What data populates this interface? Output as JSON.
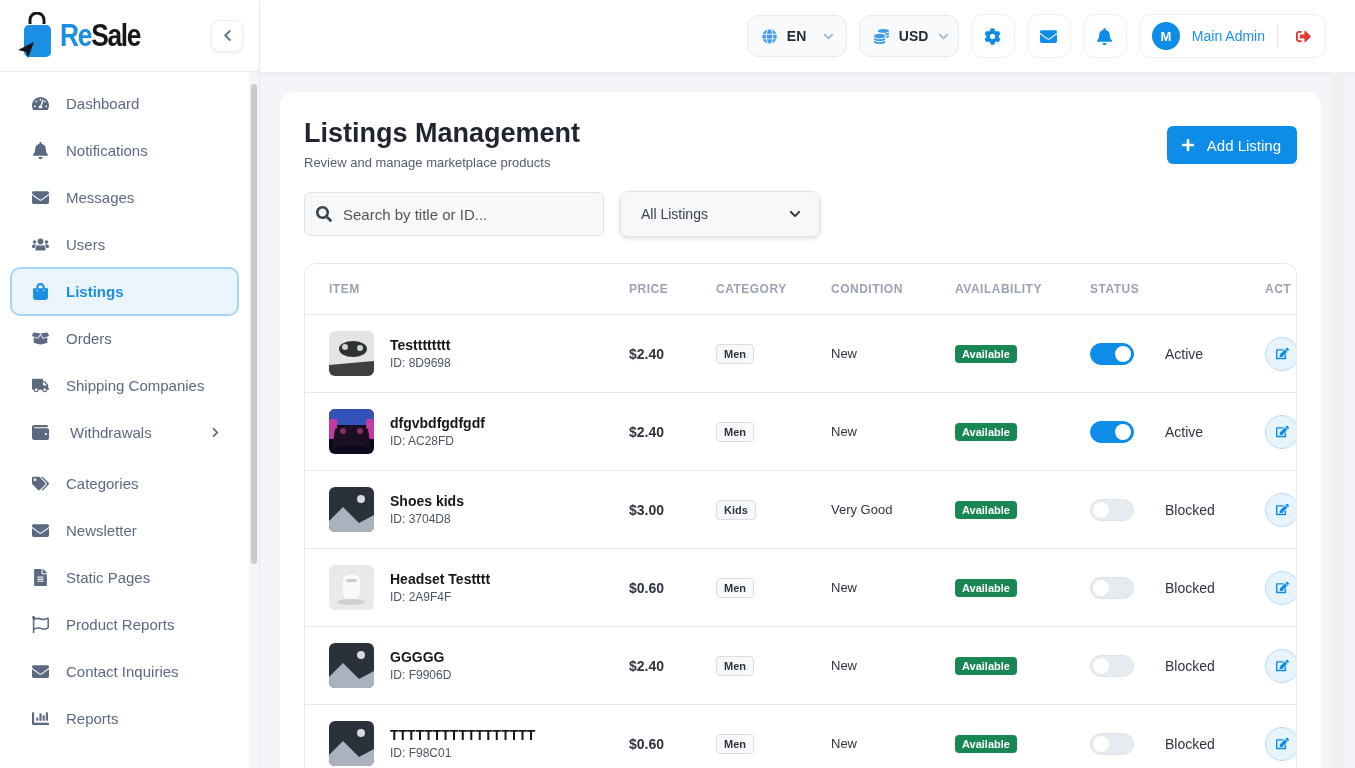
{
  "logo": {
    "prefix": "Re",
    "suffix": "Sale"
  },
  "sidebar": {
    "items": [
      {
        "label": "Dashboard",
        "selected": false,
        "kind": "link"
      },
      {
        "label": "Notifications",
        "selected": false,
        "kind": "link"
      },
      {
        "label": "Messages",
        "selected": false,
        "kind": "link"
      },
      {
        "label": "Users",
        "selected": false,
        "kind": "link"
      },
      {
        "label": "Listings",
        "selected": true,
        "kind": "link"
      },
      {
        "label": "Orders",
        "selected": false,
        "kind": "link"
      },
      {
        "label": "Shipping Companies",
        "selected": false,
        "kind": "link"
      },
      {
        "label": "Withdrawals",
        "selected": false,
        "kind": "group"
      },
      {
        "label": "Categories",
        "selected": false,
        "kind": "link"
      },
      {
        "label": "Newsletter",
        "selected": false,
        "kind": "link"
      },
      {
        "label": "Static Pages",
        "selected": false,
        "kind": "link"
      },
      {
        "label": "Product Reports",
        "selected": false,
        "kind": "link"
      },
      {
        "label": "Contact Inquiries",
        "selected": false,
        "kind": "link"
      },
      {
        "label": "Reports",
        "selected": false,
        "kind": "link"
      }
    ]
  },
  "header": {
    "language": "EN",
    "currency": "USD",
    "user": {
      "initial": "M",
      "name": "Main Admin"
    }
  },
  "page": {
    "title": "Listings Management",
    "subtitle": "Review and manage marketplace products",
    "add_button": "Add Listing",
    "search": {
      "placeholder": "Search by title or ID..."
    },
    "filter": {
      "value": "All Listings"
    }
  },
  "table": {
    "columns": [
      "ITEM",
      "PRICE",
      "CATEGORY",
      "CONDITION",
      "AVAILABILITY",
      "STATUS",
      "ACT"
    ],
    "rows": [
      {
        "name": "Testttttttt",
        "id": "ID: 8D9698",
        "price": "$2.40",
        "category": "Men",
        "condition": "New",
        "availability": "Available",
        "active": true,
        "status": "Active"
      },
      {
        "name": "dfgvbdfgdfgdf",
        "id": "ID: AC28FD",
        "price": "$2.40",
        "category": "Men",
        "condition": "New",
        "availability": "Available",
        "active": true,
        "status": "Active"
      },
      {
        "name": "Shoes kids",
        "id": "ID: 3704D8",
        "price": "$3.00",
        "category": "Kids",
        "condition": "Very Good",
        "availability": "Available",
        "active": false,
        "status": "Blocked",
        "kind": "placeholder"
      },
      {
        "name": "Headset Testttt",
        "id": "ID: 2A9F4F",
        "price": "$0.60",
        "category": "Men",
        "condition": "New",
        "availability": "Available",
        "active": false,
        "status": "Blocked"
      },
      {
        "name": "GGGGG",
        "id": "ID: F9906D",
        "price": "$2.40",
        "category": "Men",
        "condition": "New",
        "availability": "Available",
        "active": false,
        "status": "Blocked",
        "kind": "placeholder"
      },
      {
        "name": "TTTTTTTTTTTTTTTTT",
        "id": "ID: F98C01",
        "price": "$0.60",
        "category": "Men",
        "condition": "New",
        "availability": "Available",
        "active": false,
        "status": "Blocked",
        "kind": "placeholder"
      }
    ]
  }
}
